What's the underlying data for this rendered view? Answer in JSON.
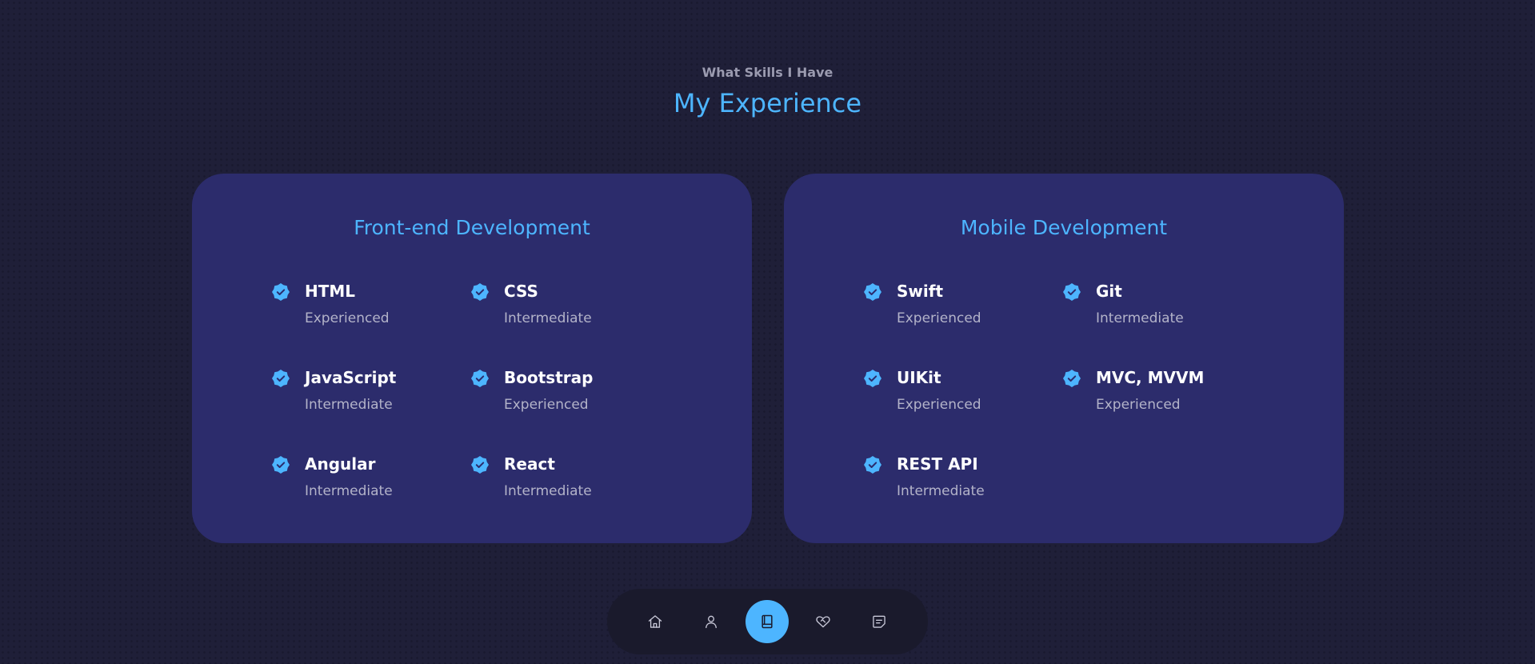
{
  "header": {
    "subtitle": "What Skills I Have",
    "title": "My Experience"
  },
  "cards": [
    {
      "title": "Front-end Development",
      "skills": [
        {
          "name": "HTML",
          "level": "Experienced"
        },
        {
          "name": "CSS",
          "level": "Intermediate"
        },
        {
          "name": "JavaScript",
          "level": "Intermediate"
        },
        {
          "name": "Bootstrap",
          "level": "Experienced"
        },
        {
          "name": "Angular",
          "level": "Intermediate"
        },
        {
          "name": "React",
          "level": "Intermediate"
        }
      ]
    },
    {
      "title": "Mobile Development",
      "skills": [
        {
          "name": "Swift",
          "level": "Experienced"
        },
        {
          "name": "Git",
          "level": "Intermediate"
        },
        {
          "name": "UIKit",
          "level": "Experienced"
        },
        {
          "name": "MVC, MVVM",
          "level": "Experienced"
        },
        {
          "name": "REST API",
          "level": "Intermediate"
        }
      ]
    }
  ],
  "nav": {
    "items": [
      {
        "icon": "home-icon"
      },
      {
        "icon": "user-icon"
      },
      {
        "icon": "book-icon",
        "active": true
      },
      {
        "icon": "heart-handshake-icon"
      },
      {
        "icon": "message-icon"
      }
    ]
  },
  "colors": {
    "background": "#1f1f38",
    "card": "#2c2c6c",
    "accent": "#4db5ff",
    "text": "#ffffff",
    "muted": "#b3b3c9"
  }
}
